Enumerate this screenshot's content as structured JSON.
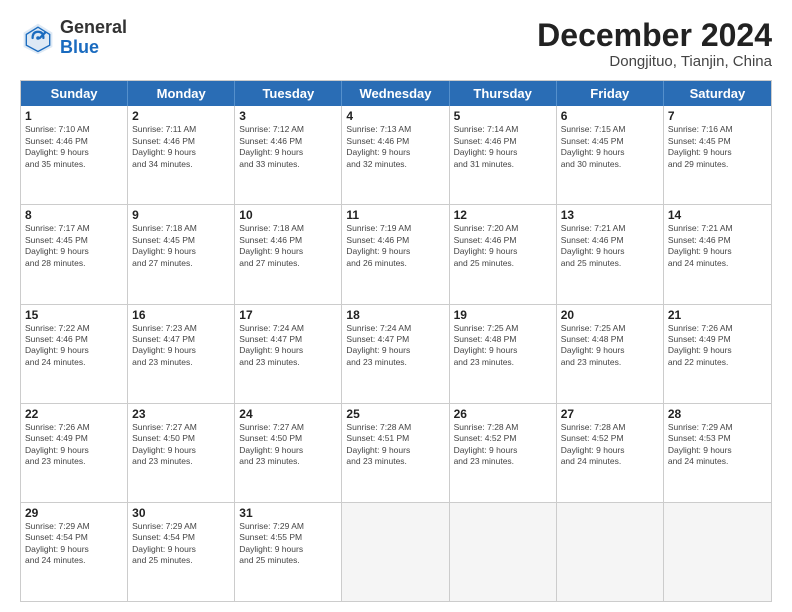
{
  "header": {
    "logo_general": "General",
    "logo_blue": "Blue",
    "month_title": "December 2024",
    "location": "Dongjituo, Tianjin, China"
  },
  "weekdays": [
    "Sunday",
    "Monday",
    "Tuesday",
    "Wednesday",
    "Thursday",
    "Friday",
    "Saturday"
  ],
  "rows": [
    [
      {
        "day": "1",
        "lines": [
          "Sunrise: 7:10 AM",
          "Sunset: 4:46 PM",
          "Daylight: 9 hours",
          "and 35 minutes."
        ]
      },
      {
        "day": "2",
        "lines": [
          "Sunrise: 7:11 AM",
          "Sunset: 4:46 PM",
          "Daylight: 9 hours",
          "and 34 minutes."
        ]
      },
      {
        "day": "3",
        "lines": [
          "Sunrise: 7:12 AM",
          "Sunset: 4:46 PM",
          "Daylight: 9 hours",
          "and 33 minutes."
        ]
      },
      {
        "day": "4",
        "lines": [
          "Sunrise: 7:13 AM",
          "Sunset: 4:46 PM",
          "Daylight: 9 hours",
          "and 32 minutes."
        ]
      },
      {
        "day": "5",
        "lines": [
          "Sunrise: 7:14 AM",
          "Sunset: 4:46 PM",
          "Daylight: 9 hours",
          "and 31 minutes."
        ]
      },
      {
        "day": "6",
        "lines": [
          "Sunrise: 7:15 AM",
          "Sunset: 4:45 PM",
          "Daylight: 9 hours",
          "and 30 minutes."
        ]
      },
      {
        "day": "7",
        "lines": [
          "Sunrise: 7:16 AM",
          "Sunset: 4:45 PM",
          "Daylight: 9 hours",
          "and 29 minutes."
        ]
      }
    ],
    [
      {
        "day": "8",
        "lines": [
          "Sunrise: 7:17 AM",
          "Sunset: 4:45 PM",
          "Daylight: 9 hours",
          "and 28 minutes."
        ]
      },
      {
        "day": "9",
        "lines": [
          "Sunrise: 7:18 AM",
          "Sunset: 4:45 PM",
          "Daylight: 9 hours",
          "and 27 minutes."
        ]
      },
      {
        "day": "10",
        "lines": [
          "Sunrise: 7:18 AM",
          "Sunset: 4:46 PM",
          "Daylight: 9 hours",
          "and 27 minutes."
        ]
      },
      {
        "day": "11",
        "lines": [
          "Sunrise: 7:19 AM",
          "Sunset: 4:46 PM",
          "Daylight: 9 hours",
          "and 26 minutes."
        ]
      },
      {
        "day": "12",
        "lines": [
          "Sunrise: 7:20 AM",
          "Sunset: 4:46 PM",
          "Daylight: 9 hours",
          "and 25 minutes."
        ]
      },
      {
        "day": "13",
        "lines": [
          "Sunrise: 7:21 AM",
          "Sunset: 4:46 PM",
          "Daylight: 9 hours",
          "and 25 minutes."
        ]
      },
      {
        "day": "14",
        "lines": [
          "Sunrise: 7:21 AM",
          "Sunset: 4:46 PM",
          "Daylight: 9 hours",
          "and 24 minutes."
        ]
      }
    ],
    [
      {
        "day": "15",
        "lines": [
          "Sunrise: 7:22 AM",
          "Sunset: 4:46 PM",
          "Daylight: 9 hours",
          "and 24 minutes."
        ]
      },
      {
        "day": "16",
        "lines": [
          "Sunrise: 7:23 AM",
          "Sunset: 4:47 PM",
          "Daylight: 9 hours",
          "and 23 minutes."
        ]
      },
      {
        "day": "17",
        "lines": [
          "Sunrise: 7:24 AM",
          "Sunset: 4:47 PM",
          "Daylight: 9 hours",
          "and 23 minutes."
        ]
      },
      {
        "day": "18",
        "lines": [
          "Sunrise: 7:24 AM",
          "Sunset: 4:47 PM",
          "Daylight: 9 hours",
          "and 23 minutes."
        ]
      },
      {
        "day": "19",
        "lines": [
          "Sunrise: 7:25 AM",
          "Sunset: 4:48 PM",
          "Daylight: 9 hours",
          "and 23 minutes."
        ]
      },
      {
        "day": "20",
        "lines": [
          "Sunrise: 7:25 AM",
          "Sunset: 4:48 PM",
          "Daylight: 9 hours",
          "and 23 minutes."
        ]
      },
      {
        "day": "21",
        "lines": [
          "Sunrise: 7:26 AM",
          "Sunset: 4:49 PM",
          "Daylight: 9 hours",
          "and 22 minutes."
        ]
      }
    ],
    [
      {
        "day": "22",
        "lines": [
          "Sunrise: 7:26 AM",
          "Sunset: 4:49 PM",
          "Daylight: 9 hours",
          "and 23 minutes."
        ]
      },
      {
        "day": "23",
        "lines": [
          "Sunrise: 7:27 AM",
          "Sunset: 4:50 PM",
          "Daylight: 9 hours",
          "and 23 minutes."
        ]
      },
      {
        "day": "24",
        "lines": [
          "Sunrise: 7:27 AM",
          "Sunset: 4:50 PM",
          "Daylight: 9 hours",
          "and 23 minutes."
        ]
      },
      {
        "day": "25",
        "lines": [
          "Sunrise: 7:28 AM",
          "Sunset: 4:51 PM",
          "Daylight: 9 hours",
          "and 23 minutes."
        ]
      },
      {
        "day": "26",
        "lines": [
          "Sunrise: 7:28 AM",
          "Sunset: 4:52 PM",
          "Daylight: 9 hours",
          "and 23 minutes."
        ]
      },
      {
        "day": "27",
        "lines": [
          "Sunrise: 7:28 AM",
          "Sunset: 4:52 PM",
          "Daylight: 9 hours",
          "and 24 minutes."
        ]
      },
      {
        "day": "28",
        "lines": [
          "Sunrise: 7:29 AM",
          "Sunset: 4:53 PM",
          "Daylight: 9 hours",
          "and 24 minutes."
        ]
      }
    ],
    [
      {
        "day": "29",
        "lines": [
          "Sunrise: 7:29 AM",
          "Sunset: 4:54 PM",
          "Daylight: 9 hours",
          "and 24 minutes."
        ]
      },
      {
        "day": "30",
        "lines": [
          "Sunrise: 7:29 AM",
          "Sunset: 4:54 PM",
          "Daylight: 9 hours",
          "and 25 minutes."
        ]
      },
      {
        "day": "31",
        "lines": [
          "Sunrise: 7:29 AM",
          "Sunset: 4:55 PM",
          "Daylight: 9 hours",
          "and 25 minutes."
        ]
      },
      {
        "day": "",
        "lines": []
      },
      {
        "day": "",
        "lines": []
      },
      {
        "day": "",
        "lines": []
      },
      {
        "day": "",
        "lines": []
      }
    ]
  ]
}
